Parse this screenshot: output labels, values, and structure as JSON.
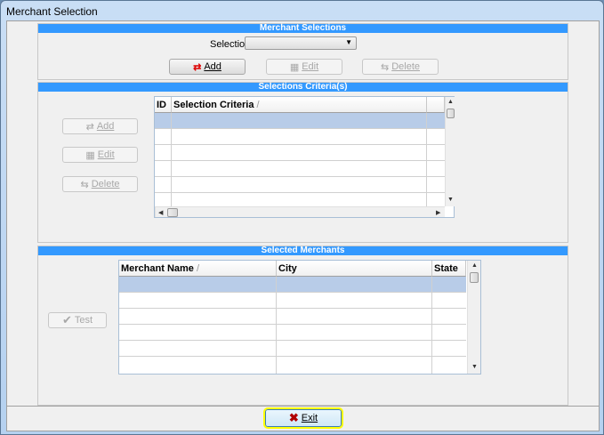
{
  "window": {
    "title": "Merchant Selection"
  },
  "merchant_selections": {
    "header": "Merchant Selections",
    "selections_label": "Selections",
    "selections_value": "",
    "add": "Add",
    "edit": "Edit",
    "delete": "Delete"
  },
  "criteria": {
    "header": "Selections Criteria(s)",
    "add": "Add",
    "edit": "Edit",
    "delete": "Delete",
    "columns": [
      "ID",
      "Selection Criteria"
    ],
    "sort_glyph": "/"
  },
  "merchants": {
    "header": "Selected Merchants",
    "test": "Test",
    "columns": [
      "Merchant Name",
      "City",
      "State"
    ],
    "sort_glyph": "/"
  },
  "exit": "Exit",
  "colors": {
    "section_header": "#3399ff",
    "selected_row": "#b8cce8",
    "focus": "#ffff00"
  }
}
